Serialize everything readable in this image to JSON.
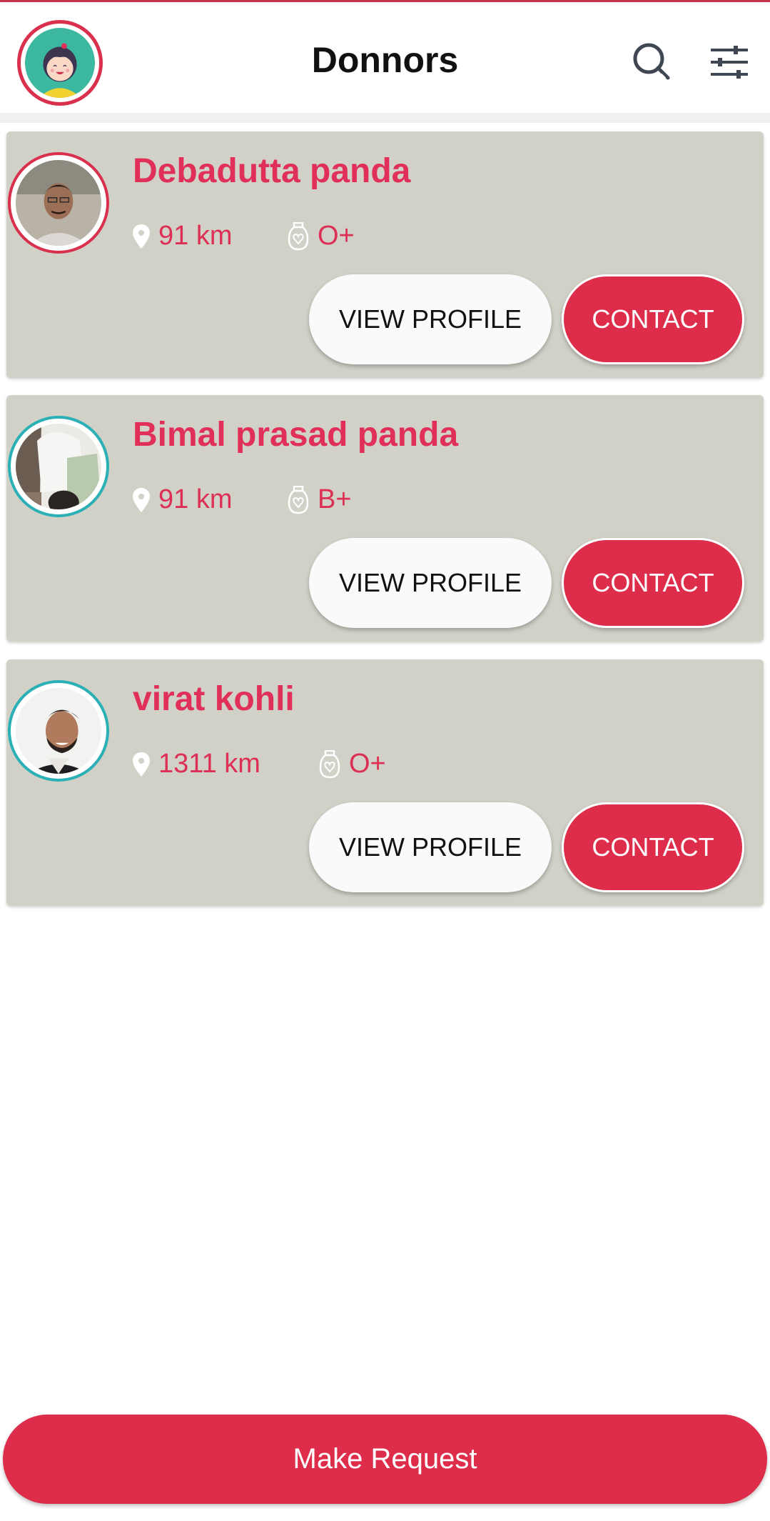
{
  "colors": {
    "accent": "#de2d4a",
    "name_text": "#e0305a",
    "card_background": "#d1d1c8",
    "teal_ring": "#2ab0b5"
  },
  "header": {
    "title": "Donnors",
    "avatar_icon": "cartoon-girl-avatar",
    "search_icon": "search-icon",
    "filter_icon": "sliders-icon"
  },
  "donors": [
    {
      "name": "Debadutta panda",
      "distance": "91 km",
      "blood_group": "O+",
      "ring_color": "#d8304d",
      "view_label": "VIEW PROFILE",
      "contact_label": "CONTACT"
    },
    {
      "name": "Bimal prasad panda",
      "distance": "91 km",
      "blood_group": "B+",
      "ring_color": "#2ab0b5",
      "view_label": "VIEW PROFILE",
      "contact_label": "CONTACT"
    },
    {
      "name": "virat kohli",
      "distance": "1311 km",
      "blood_group": "O+",
      "ring_color": "#2ab0b5",
      "view_label": "VIEW PROFILE",
      "contact_label": "CONTACT"
    }
  ],
  "footer": {
    "make_request_label": "Make Request"
  }
}
